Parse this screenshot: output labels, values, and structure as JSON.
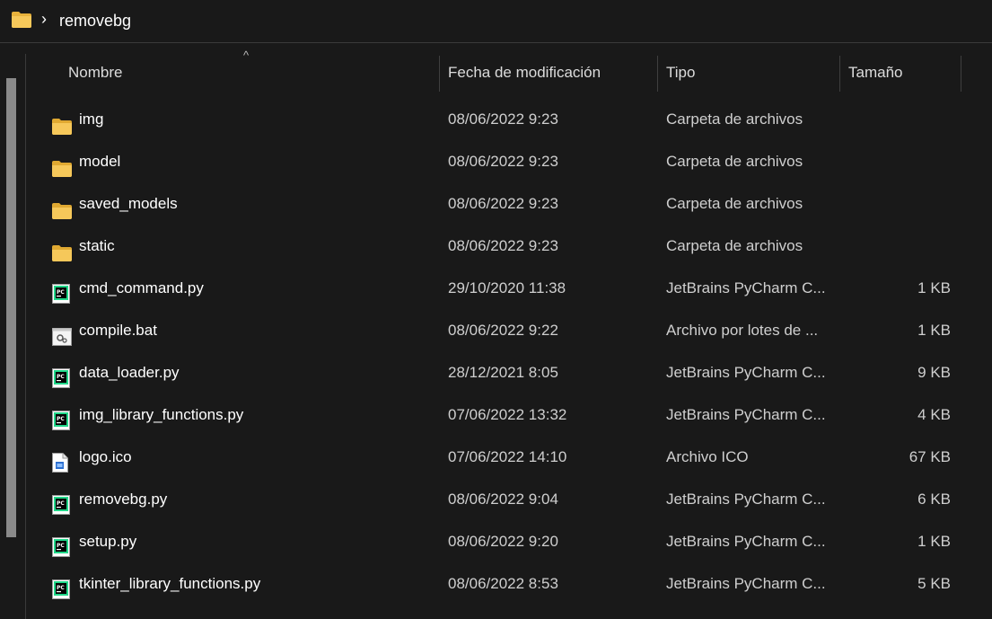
{
  "breadcrumb": {
    "chevron": "›",
    "current": "removebg"
  },
  "columns": {
    "name": "Nombre",
    "date": "Fecha de modificación",
    "type": "Tipo",
    "size": "Tamaño"
  },
  "sort_arrow": "^",
  "rows": [
    {
      "icon": "folder-icon",
      "name": "img",
      "date": "08/06/2022 9:23",
      "type": "Carpeta de archivos",
      "size": ""
    },
    {
      "icon": "folder-icon",
      "name": "model",
      "date": "08/06/2022 9:23",
      "type": "Carpeta de archivos",
      "size": ""
    },
    {
      "icon": "folder-icon",
      "name": "saved_models",
      "date": "08/06/2022 9:23",
      "type": "Carpeta de archivos",
      "size": ""
    },
    {
      "icon": "folder-icon",
      "name": "static",
      "date": "08/06/2022 9:23",
      "type": "Carpeta de archivos",
      "size": ""
    },
    {
      "icon": "pycharm-file-icon",
      "name": "cmd_command.py",
      "date": "29/10/2020 11:38",
      "type": "JetBrains PyCharm C...",
      "size": "1 KB"
    },
    {
      "icon": "batch-file-icon",
      "name": "compile.bat",
      "date": "08/06/2022 9:22",
      "type": "Archivo por lotes de ...",
      "size": "1 KB"
    },
    {
      "icon": "pycharm-file-icon",
      "name": "data_loader.py",
      "date": "28/12/2021 8:05",
      "type": "JetBrains PyCharm C...",
      "size": "9 KB"
    },
    {
      "icon": "pycharm-file-icon",
      "name": "img_library_functions.py",
      "date": "07/06/2022 13:32",
      "type": "JetBrains PyCharm C...",
      "size": "4 KB"
    },
    {
      "icon": "ico-file-icon",
      "name": "logo.ico",
      "date": "07/06/2022 14:10",
      "type": "Archivo ICO",
      "size": "67 KB"
    },
    {
      "icon": "pycharm-file-icon",
      "name": "removebg.py",
      "date": "08/06/2022 9:04",
      "type": "JetBrains PyCharm C...",
      "size": "6 KB"
    },
    {
      "icon": "pycharm-file-icon",
      "name": "setup.py",
      "date": "08/06/2022 9:20",
      "type": "JetBrains PyCharm C...",
      "size": "1 KB"
    },
    {
      "icon": "pycharm-file-icon",
      "name": "tkinter_library_functions.py",
      "date": "08/06/2022 8:53",
      "type": "JetBrains PyCharm C...",
      "size": "5 KB"
    }
  ],
  "colors": {
    "background": "#191919",
    "folder": "#f2c14e",
    "pycharm_green": "#21d789",
    "pycharm_badge": "#000000"
  }
}
